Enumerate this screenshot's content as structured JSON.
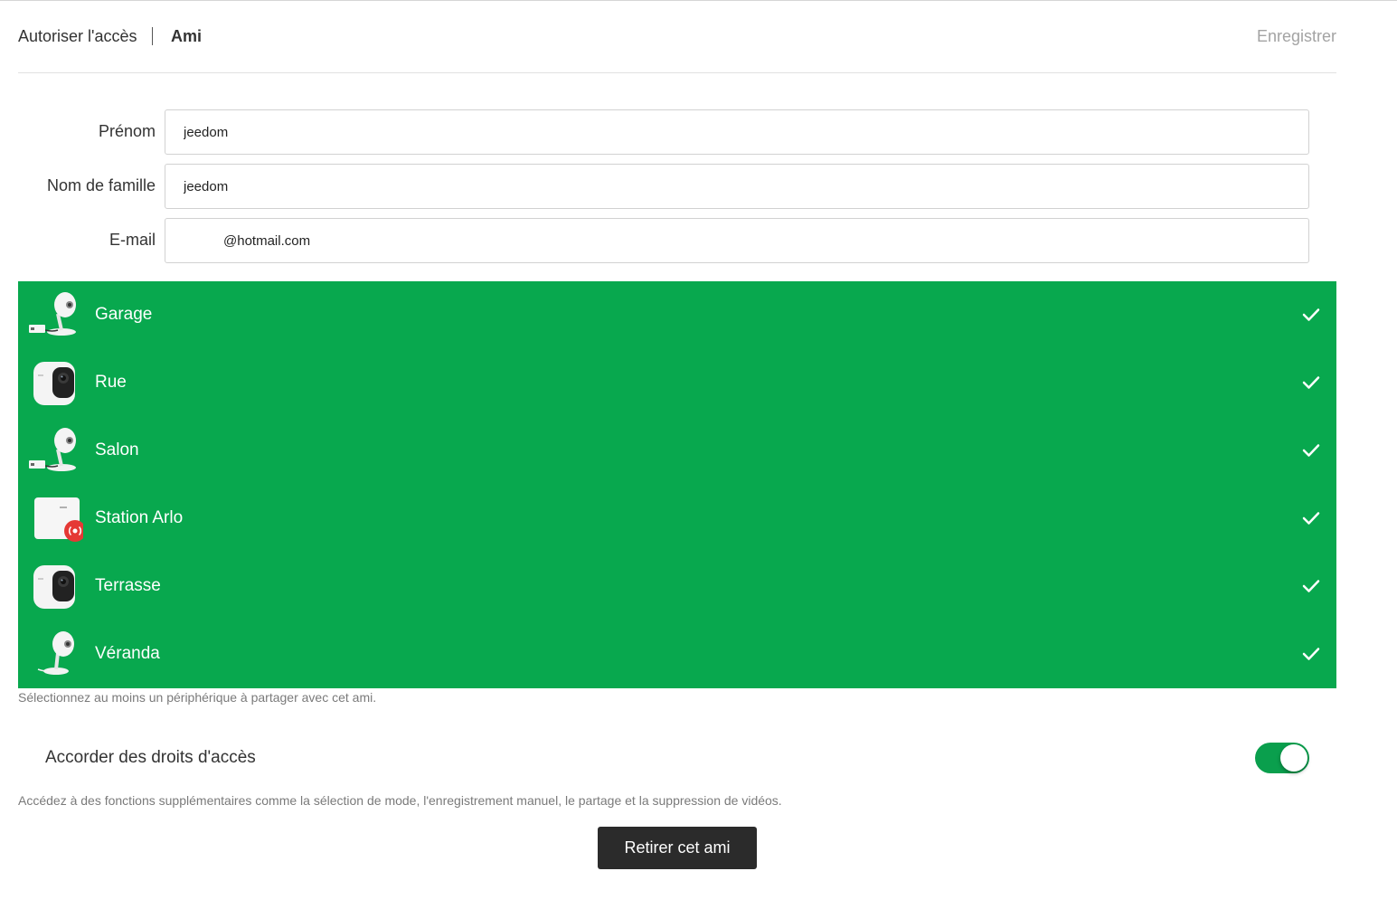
{
  "header": {
    "breadcrumb_parent": "Autoriser l'accès",
    "breadcrumb_current": "Ami",
    "save_label": "Enregistrer"
  },
  "form": {
    "first_name_label": "Prénom",
    "first_name_value": "jeedom",
    "last_name_label": "Nom de famille",
    "last_name_value": "jeedom",
    "email_label": "E-mail",
    "email_value": "@hotmail.com"
  },
  "devices": {
    "selected_color": "#08a84e",
    "items": [
      {
        "name": "Garage",
        "icon": "arlo-q-camera-icon",
        "selected": true
      },
      {
        "name": "Rue",
        "icon": "arlo-pro-camera-icon",
        "selected": true
      },
      {
        "name": "Salon",
        "icon": "arlo-q-camera-icon",
        "selected": true
      },
      {
        "name": "Station Arlo",
        "icon": "arlo-base-station-icon",
        "selected": true
      },
      {
        "name": "Terrasse",
        "icon": "arlo-pro-camera-icon",
        "selected": true
      },
      {
        "name": "Véranda",
        "icon": "arlo-q-camera-icon",
        "selected": true
      }
    ],
    "helper_text": "Sélectionnez au moins un périphérique à partager avec cet ami."
  },
  "access": {
    "label": "Accorder des droits d'accès",
    "enabled": true,
    "toggle_color": "#0a9f4d",
    "helper_text": "Accédez à des fonctions supplémentaires comme la sélection de mode, l'enregistrement manuel, le partage et la suppression de vidéos."
  },
  "remove_button_label": "Retirer cet ami"
}
